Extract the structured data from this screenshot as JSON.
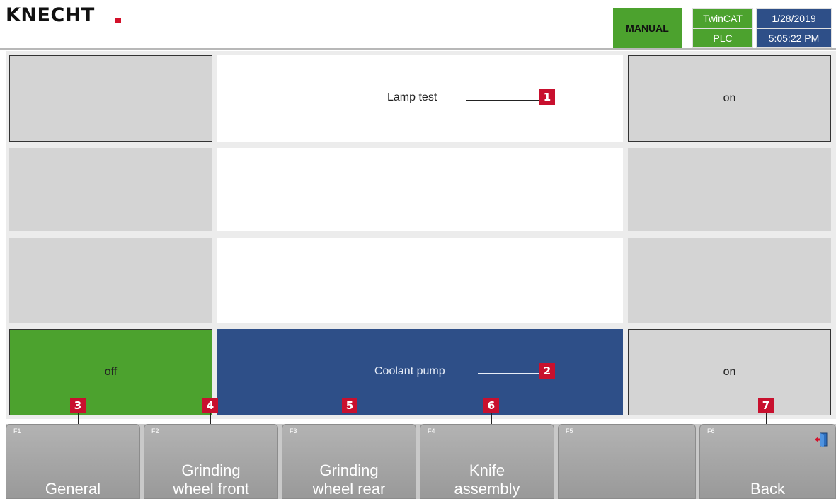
{
  "header": {
    "logo": "KNECHT",
    "mode": "MANUAL",
    "twincat": "TwinCAT",
    "plc": "PLC",
    "date": "1/28/2019",
    "time": "5:05:22 PM",
    "brand_red": "#d3102a",
    "status_green": "#4ca22e",
    "info_blue": "#2e4f88"
  },
  "rows": [
    {
      "left": "",
      "center": "Lamp test",
      "right": "on"
    },
    {
      "left": "",
      "center": "",
      "right": ""
    },
    {
      "left": "",
      "center": "",
      "right": ""
    },
    {
      "left": "off",
      "center": "Coolant pump",
      "right": "on"
    }
  ],
  "markers": [
    "1",
    "2",
    "3",
    "4",
    "5",
    "6",
    "7"
  ],
  "fkeys": [
    {
      "num": "F1",
      "label": "General"
    },
    {
      "num": "F2",
      "label": "Grinding\nwheel front"
    },
    {
      "num": "F3",
      "label": "Grinding\nwheel rear"
    },
    {
      "num": "F4",
      "label": "Knife\nassembly"
    },
    {
      "num": "F5",
      "label": ""
    },
    {
      "num": "F6",
      "label": "Back",
      "icon": "exit-door-icon"
    }
  ]
}
